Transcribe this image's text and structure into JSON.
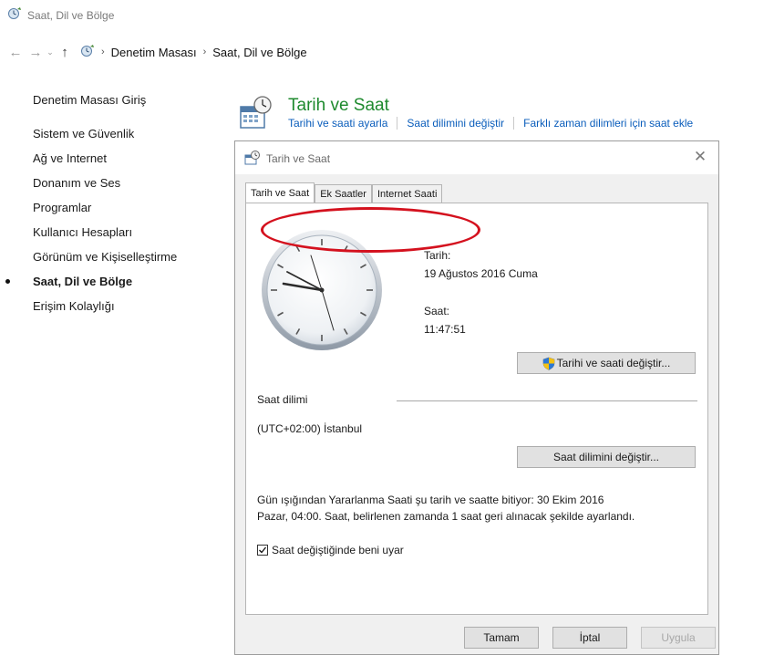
{
  "window": {
    "title": "Saat, Dil ve Bölge"
  },
  "nav": {
    "back_icon": "arrow-left-icon",
    "forward_icon": "arrow-right-icon",
    "up_icon": "arrow-up-icon",
    "breadcrumb": [
      "Denetim Masası",
      "Saat, Dil ve Bölge"
    ]
  },
  "sidebar": {
    "items": [
      {
        "label": "Denetim Masası Giriş"
      },
      {
        "label": "Sistem ve Güvenlik"
      },
      {
        "label": "Ağ ve Internet"
      },
      {
        "label": "Donanım ve Ses"
      },
      {
        "label": "Programlar"
      },
      {
        "label": "Kullanıcı Hesapları"
      },
      {
        "label": "Görünüm ve Kişiselleştirme"
      },
      {
        "label": "Saat, Dil ve Bölge",
        "active": true
      },
      {
        "label": "Erişim Kolaylığı"
      }
    ]
  },
  "category": {
    "title": "Tarih ve Saat",
    "links": [
      "Tarihi ve saati ayarla",
      "Saat dilimini değiştir",
      "Farklı zaman dilimleri için saat ekle"
    ]
  },
  "dialog": {
    "title": "Tarih ve Saat",
    "tabs": [
      "Tarih ve Saat",
      "Ek Saatler",
      "Internet Saati"
    ],
    "active_tab": "Tarih ve Saat",
    "date_label": "Tarih:",
    "date_value": "19 Ağustos 2016 Cuma",
    "time_label": "Saat:",
    "time_value": "11:47:51",
    "change_datetime_button": "Tarihi ve saati değiştir...",
    "timezone_label": "Saat dilimi",
    "timezone_value": "(UTC+02:00) İstanbul",
    "change_timezone_button": "Saat dilimini değiştir...",
    "dst_line1": "Gün ışığından Yararlanma Saati şu tarih ve saatte bitiyor: 30 Ekim 2016",
    "dst_line2": "Pazar, 04:00. Saat, belirlenen zamanda 1 saat geri alınacak şekilde ayarlandı.",
    "notify_checkbox_label": "Saat değiştiğinde beni uyar",
    "notify_checked": true,
    "ok_button": "Tamam",
    "cancel_button": "İptal",
    "apply_button": "Uygula",
    "apply_enabled": false
  },
  "colors": {
    "link": "#0a5dbb",
    "category_title": "#1e8a2e",
    "highlight_oval": "#d4111e"
  }
}
